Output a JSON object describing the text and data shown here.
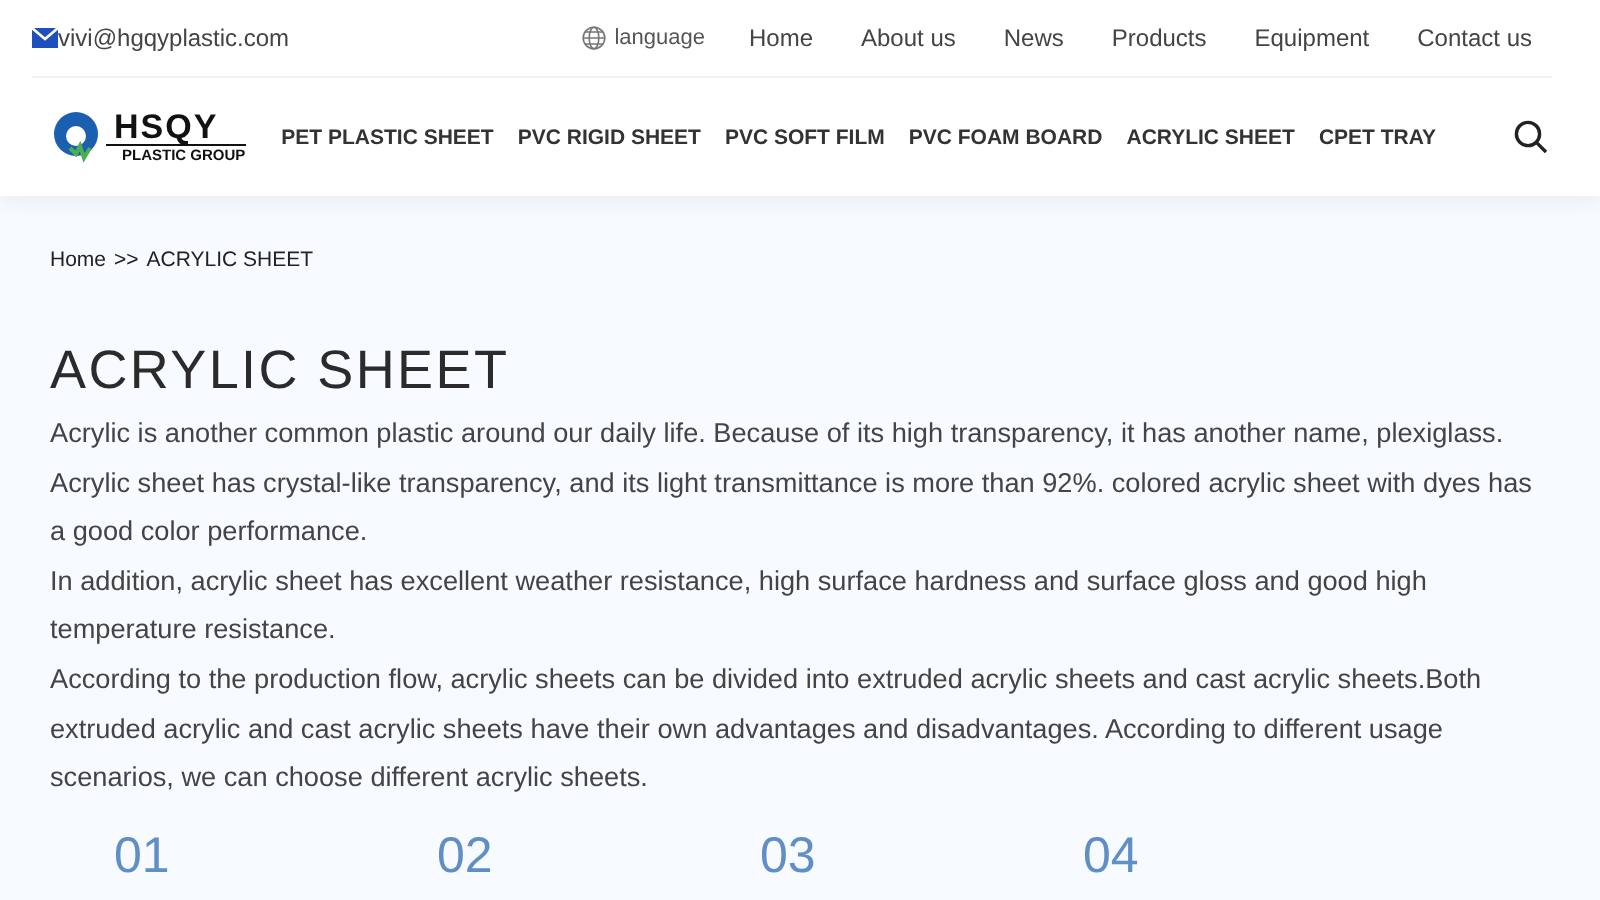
{
  "top_bar": {
    "email": "vivi@hgqyplastic.com",
    "language": "language",
    "links": [
      "Home",
      "About us",
      "News",
      "Products",
      "Equipment",
      "Contact us"
    ]
  },
  "header": {
    "logo": {
      "name": "HSQY",
      "tagline": "PLASTIC GROUP"
    },
    "nav": [
      "PET PLASTIC SHEET",
      "PVC RIGID SHEET",
      "PVC SOFT FILM",
      "PVC FOAM BOARD",
      "ACRYLIC SHEET",
      "CPET TRAY"
    ]
  },
  "breadcrumb": {
    "items": [
      "Home",
      "ACRYLIC SHEET"
    ],
    "separator": ">>"
  },
  "title": "ACRYLIC SHEET",
  "paragraphs": [
    "Acrylic is another common plastic around our daily life. Because of its high transparency, it has another name, plexiglass. Acrylic sheet has crystal-like transparency, and its light transmittance is more than 92%. colored acrylic sheet with dyes has a good color performance.",
    "In addition, acrylic sheet has excellent weather resistance, high surface hardness and surface gloss and good high temperature resistance.",
    "According to the production flow, acrylic sheets can be divided into extruded acrylic sheets and cast acrylic sheets.Both extruded acrylic and cast acrylic sheets have their own advantages and disadvantages. According to different usage scenarios, we can choose different acrylic sheets."
  ],
  "steps": [
    "01",
    "02",
    "03",
    "04"
  ]
}
